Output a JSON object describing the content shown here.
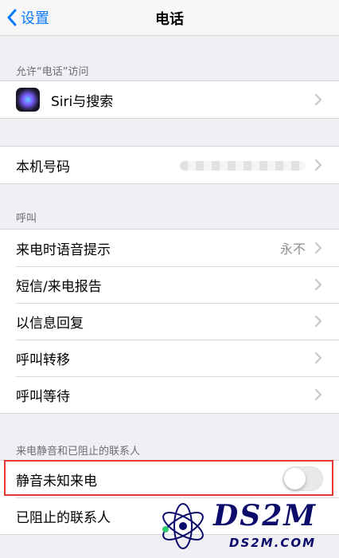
{
  "navbar": {
    "back_label": "设置",
    "title": "电话"
  },
  "sections": {
    "allow_access": {
      "header": "允许“电话”访问",
      "siri_label": "Siri与搜索"
    },
    "my_number": {
      "label": "本机号码"
    },
    "calls": {
      "header": "呼叫",
      "announce_label": "来电时语音提示",
      "announce_value": "永不",
      "sms_report_label": "短信/来电报告",
      "reply_label": "以信息回复",
      "forwarding_label": "呼叫转移",
      "waiting_label": "呼叫等待"
    },
    "silence": {
      "header": "来电静音和已阻止的联系人",
      "silence_unknown_label": "静音未知来电",
      "silence_unknown_on": false,
      "blocked_label": "已阻止的联系人"
    }
  },
  "watermark": {
    "logo_text": "DS2M",
    "url": "DS2M.COM"
  },
  "colors": {
    "accent": "#0a7aff",
    "highlight": "#e53935",
    "watermark": "#0b0b6b"
  }
}
